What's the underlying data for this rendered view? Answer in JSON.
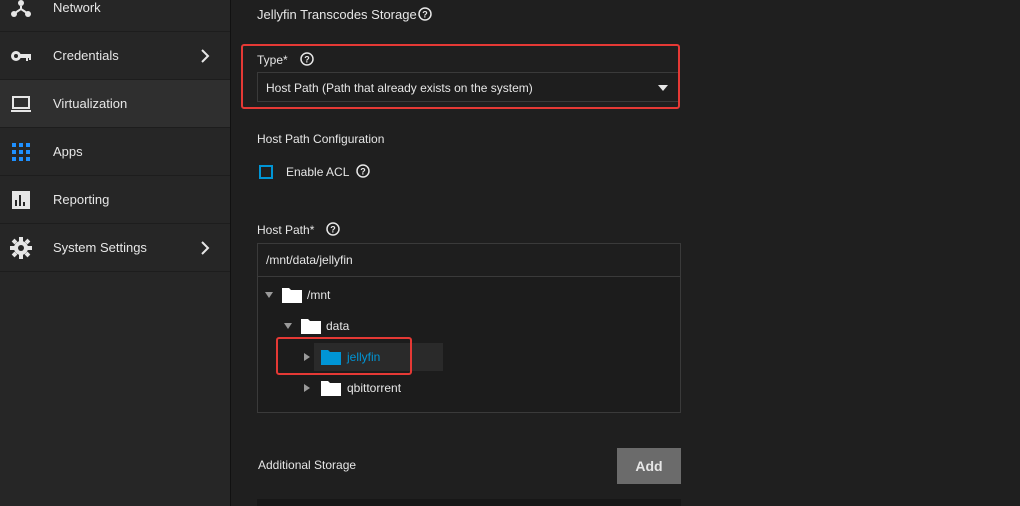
{
  "sidebar": {
    "items": [
      {
        "label": "Network",
        "icon": "network-icon"
      },
      {
        "label": "Credentials",
        "icon": "key-icon",
        "has_chevron": true
      },
      {
        "label": "Virtualization",
        "icon": "laptop-icon",
        "active": true
      },
      {
        "label": "Apps",
        "icon": "apps-grid-icon"
      },
      {
        "label": "Reporting",
        "icon": "chart-icon"
      },
      {
        "label": "System Settings",
        "icon": "gear-icon",
        "has_chevron": true
      }
    ]
  },
  "form": {
    "section_title": "Jellyfin Transcodes Storage",
    "type": {
      "label": "Type",
      "required_mark": "*",
      "selected": "Host Path (Path that already exists on the system)"
    },
    "host_path_config": {
      "title": "Host Path Configuration",
      "enable_acl_label": "Enable ACL",
      "enable_acl_checked": false
    },
    "host_path": {
      "label": "Host Path",
      "required_mark": "*",
      "value": "/mnt/data/jellyfin"
    },
    "tree": [
      {
        "label": "/mnt",
        "expanded": true,
        "selected": false
      },
      {
        "label": "data",
        "expanded": true,
        "selected": false
      },
      {
        "label": "jellyfin",
        "expanded": false,
        "selected": true
      },
      {
        "label": "qbittorrent",
        "expanded": false,
        "selected": false
      }
    ],
    "additional_storage": {
      "label": "Additional Storage",
      "add_button": "Add"
    }
  },
  "colors": {
    "accent": "#0095d5",
    "highlight_box": "#e53935",
    "background": "#1f1f1f",
    "sidebar": "#262626"
  }
}
